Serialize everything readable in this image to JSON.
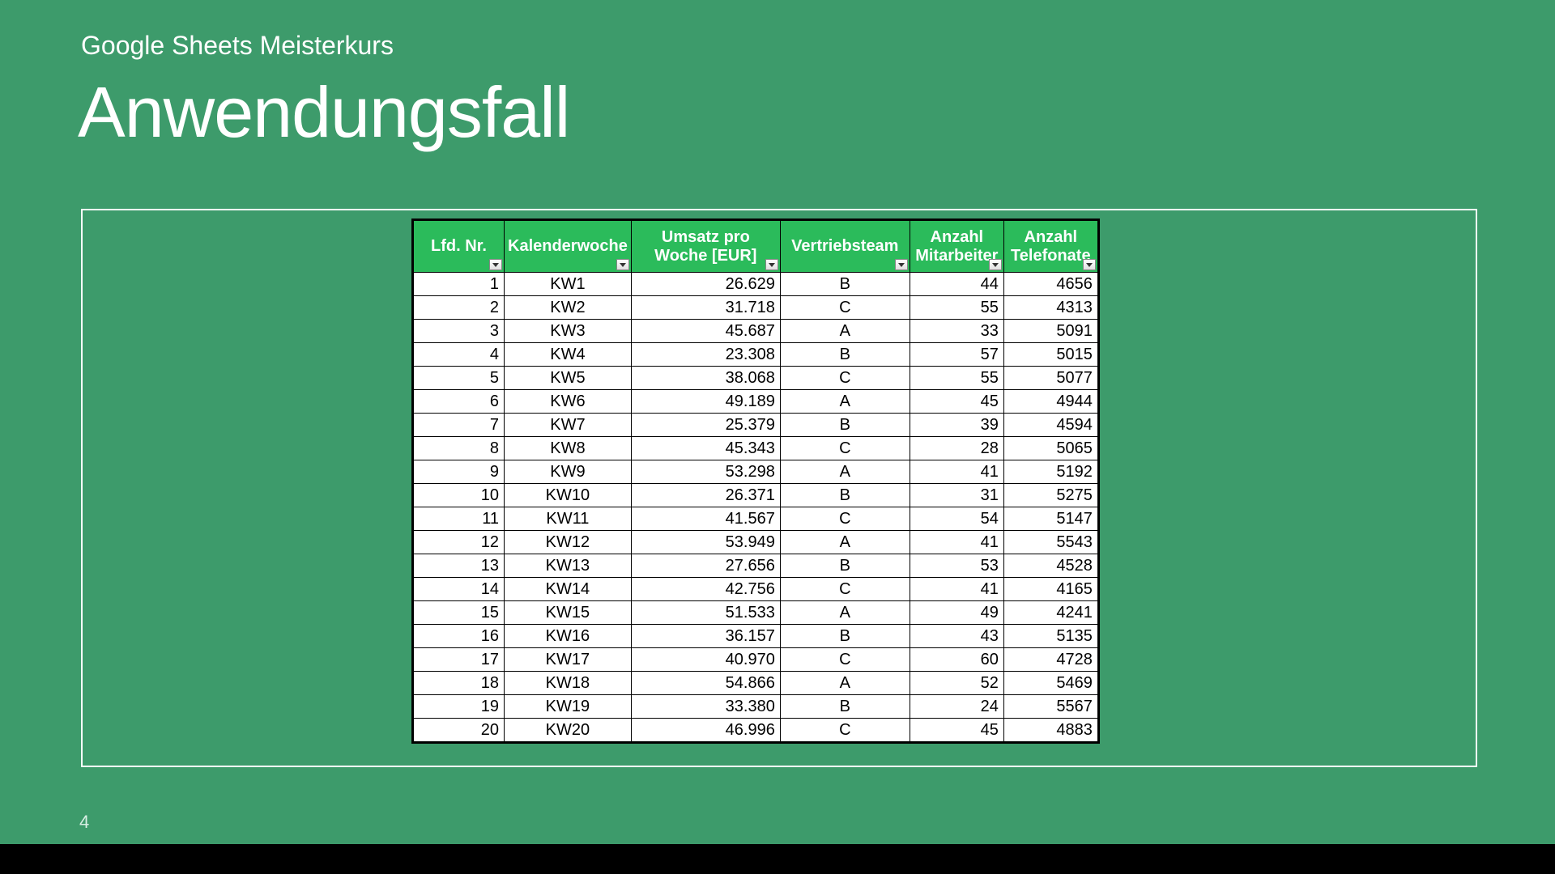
{
  "subtitle": "Google Sheets Meisterkurs",
  "title": "Anwendungsfall",
  "page_number": "4",
  "columns": {
    "c0": "Lfd. Nr.",
    "c1": "Kalenderwoche",
    "c2": "Umsatz pro Woche [EUR]",
    "c3": "Vertriebsteam",
    "c4": "Anzahl Mitarbeiter",
    "c5": "Anzahl Telefonate"
  },
  "rows": [
    {
      "nr": "1",
      "kw": "KW1",
      "umsatz": "26.629",
      "team": "B",
      "mit": "44",
      "tel": "4656"
    },
    {
      "nr": "2",
      "kw": "KW2",
      "umsatz": "31.718",
      "team": "C",
      "mit": "55",
      "tel": "4313"
    },
    {
      "nr": "3",
      "kw": "KW3",
      "umsatz": "45.687",
      "team": "A",
      "mit": "33",
      "tel": "5091"
    },
    {
      "nr": "4",
      "kw": "KW4",
      "umsatz": "23.308",
      "team": "B",
      "mit": "57",
      "tel": "5015"
    },
    {
      "nr": "5",
      "kw": "KW5",
      "umsatz": "38.068",
      "team": "C",
      "mit": "55",
      "tel": "5077"
    },
    {
      "nr": "6",
      "kw": "KW6",
      "umsatz": "49.189",
      "team": "A",
      "mit": "45",
      "tel": "4944"
    },
    {
      "nr": "7",
      "kw": "KW7",
      "umsatz": "25.379",
      "team": "B",
      "mit": "39",
      "tel": "4594"
    },
    {
      "nr": "8",
      "kw": "KW8",
      "umsatz": "45.343",
      "team": "C",
      "mit": "28",
      "tel": "5065"
    },
    {
      "nr": "9",
      "kw": "KW9",
      "umsatz": "53.298",
      "team": "A",
      "mit": "41",
      "tel": "5192"
    },
    {
      "nr": "10",
      "kw": "KW10",
      "umsatz": "26.371",
      "team": "B",
      "mit": "31",
      "tel": "5275"
    },
    {
      "nr": "11",
      "kw": "KW11",
      "umsatz": "41.567",
      "team": "C",
      "mit": "54",
      "tel": "5147"
    },
    {
      "nr": "12",
      "kw": "KW12",
      "umsatz": "53.949",
      "team": "A",
      "mit": "41",
      "tel": "5543"
    },
    {
      "nr": "13",
      "kw": "KW13",
      "umsatz": "27.656",
      "team": "B",
      "mit": "53",
      "tel": "4528"
    },
    {
      "nr": "14",
      "kw": "KW14",
      "umsatz": "42.756",
      "team": "C",
      "mit": "41",
      "tel": "4165"
    },
    {
      "nr": "15",
      "kw": "KW15",
      "umsatz": "51.533",
      "team": "A",
      "mit": "49",
      "tel": "4241"
    },
    {
      "nr": "16",
      "kw": "KW16",
      "umsatz": "36.157",
      "team": "B",
      "mit": "43",
      "tel": "5135"
    },
    {
      "nr": "17",
      "kw": "KW17",
      "umsatz": "40.970",
      "team": "C",
      "mit": "60",
      "tel": "4728"
    },
    {
      "nr": "18",
      "kw": "KW18",
      "umsatz": "54.866",
      "team": "A",
      "mit": "52",
      "tel": "5469"
    },
    {
      "nr": "19",
      "kw": "KW19",
      "umsatz": "33.380",
      "team": "B",
      "mit": "24",
      "tel": "5567"
    },
    {
      "nr": "20",
      "kw": "KW20",
      "umsatz": "46.996",
      "team": "C",
      "mit": "45",
      "tel": "4883"
    }
  ]
}
